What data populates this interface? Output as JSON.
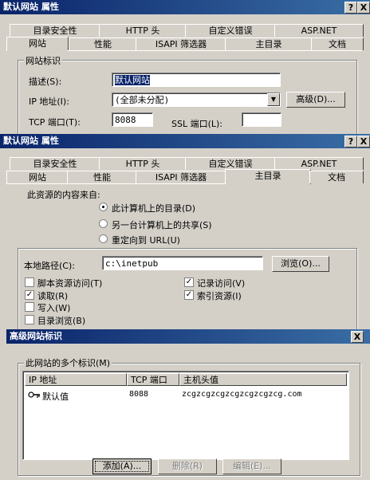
{
  "win1": {
    "title": "默认网站 属性",
    "help_btn": "?",
    "close_btn": "X",
    "tabs_row1": [
      "目录安全性",
      "HTTP 头",
      "自定义错误",
      "ASP.NET"
    ],
    "tabs_row2": [
      "网站",
      "性能",
      "ISAPI 筛选器",
      "主目录",
      "文档"
    ],
    "group_title": "网站标识",
    "desc_label": "描述(S):",
    "desc_value": "默认网站",
    "ip_label": "IP 地址(I):",
    "ip_value": "(全部未分配)",
    "advanced_btn": "高级(D)...",
    "tcp_label": "TCP 端口(T):",
    "tcp_value": "8088",
    "ssl_label": "SSL 端口(L):",
    "ssl_value": ""
  },
  "win2": {
    "title": "默认网站 属性",
    "help_btn": "?",
    "close_btn": "X",
    "tabs_row1": [
      "目录安全性",
      "HTTP 头",
      "自定义错误",
      "ASP.NET"
    ],
    "tabs_row2": [
      "网站",
      "性能",
      "ISAPI 筛选器",
      "主目录",
      "文档"
    ],
    "source_label": "此资源的内容来自:",
    "radio1": "此计算机上的目录(D)",
    "radio2": "另一台计算机上的共享(S)",
    "radio3": "重定向到 URL(U)",
    "local_path_label": "本地路径(C):",
    "local_path_value": "c:\\inetpub",
    "browse_btn": "浏览(O)...",
    "chk_script": "脚本资源访问(T)",
    "chk_read": "读取(R)",
    "chk_write": "写入(W)",
    "chk_browse": "目录浏览(B)",
    "chk_log": "记录访问(V)",
    "chk_index": "索引资源(I)",
    "checked_mark": "✓"
  },
  "win3": {
    "title": "高级网站标识",
    "close_btn": "X",
    "group_title": "此网站的多个标识(M)",
    "columns": [
      "IP 地址",
      "TCP 端口",
      "主机头值"
    ],
    "rows": [
      {
        "ip": "默认值",
        "port": "8088",
        "host": "zcgzcgzcgzcgzcgzcgzcg.com"
      }
    ],
    "add_btn": "添加(A)...",
    "delete_btn": "删除(R)",
    "edit_btn": "编辑(E)..."
  }
}
